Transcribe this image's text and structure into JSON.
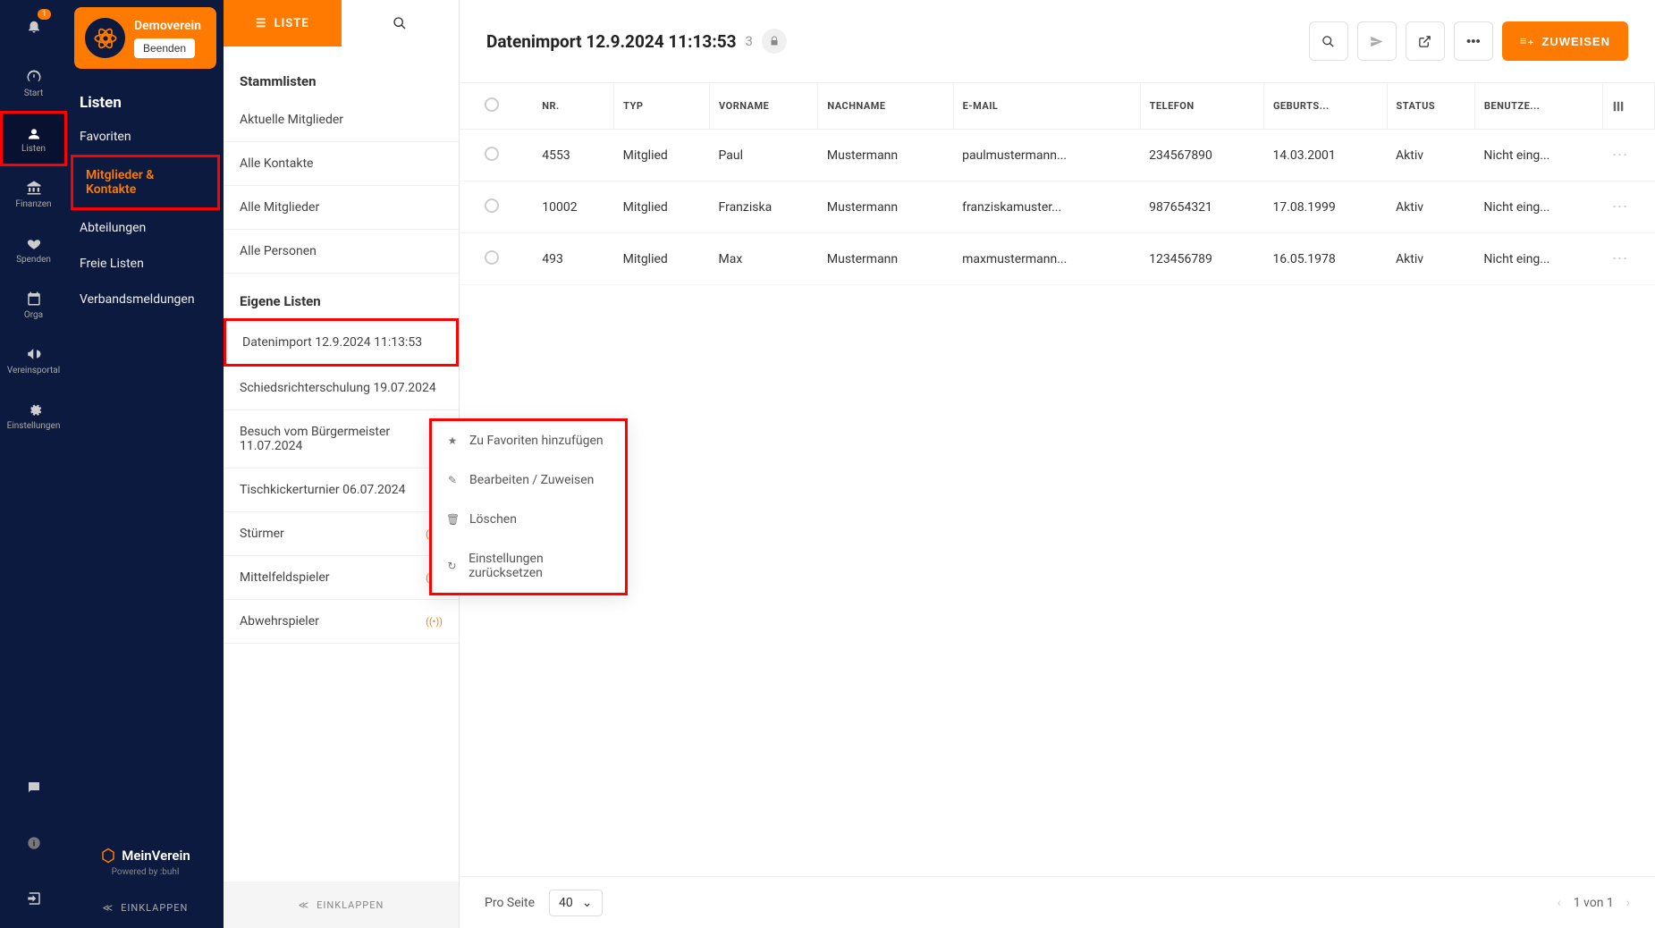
{
  "org": {
    "name": "Demoverein",
    "exit_label": "Beenden"
  },
  "rail": {
    "items": [
      {
        "icon": "bell",
        "label": "",
        "badge": "1"
      },
      {
        "icon": "dashboard",
        "label": "Start"
      },
      {
        "icon": "users",
        "label": "Listen",
        "active": true,
        "highlighted": true
      },
      {
        "icon": "bank",
        "label": "Finanzen"
      },
      {
        "icon": "hands",
        "label": "Spenden"
      },
      {
        "icon": "calendar",
        "label": "Orga"
      },
      {
        "icon": "megaphone",
        "label": "Vereinsportal"
      },
      {
        "icon": "gear",
        "label": "Einstellungen"
      }
    ],
    "bottom": [
      {
        "icon": "chat",
        "label": ""
      },
      {
        "icon": "info",
        "label": ""
      },
      {
        "icon": "logout",
        "label": ""
      }
    ]
  },
  "side2": {
    "heading": "Listen",
    "items": [
      {
        "label": "Favoriten"
      },
      {
        "label": "Mitglieder & Kontakte",
        "active": true,
        "highlighted": true
      },
      {
        "label": "Abteilungen"
      },
      {
        "label": "Freie Listen"
      },
      {
        "label": "Verbandsmeldungen"
      }
    ],
    "brand": "MeinVerein",
    "powered": "Powered by :buhl",
    "collapse": "EINKLAPPEN"
  },
  "panel3": {
    "tab_label": "LISTE",
    "sections": [
      {
        "title": "Stammlisten",
        "items": [
          {
            "label": "Aktuelle Mitglieder"
          },
          {
            "label": "Alle Kontakte"
          },
          {
            "label": "Alle Mitglieder"
          },
          {
            "label": "Alle Personen"
          }
        ]
      },
      {
        "title": "Eigene Listen",
        "items": [
          {
            "label": "Datenimport 12.9.2024 11:13:53",
            "highlighted": true
          },
          {
            "label": "Schiedsrichterschulung 19.07.2024"
          },
          {
            "label": "Besuch vom Bürgermeister 11.07.2024"
          },
          {
            "label": "Tischkickerturnier 06.07.2024"
          },
          {
            "label": "Stürmer",
            "live": true
          },
          {
            "label": "Mittelfeldspieler",
            "live": true
          },
          {
            "label": "Abwehrspieler",
            "live": true
          }
        ]
      }
    ],
    "collapse": "EINKLAPPEN"
  },
  "context_menu": {
    "items": [
      {
        "icon": "★",
        "label": "Zu Favoriten hinzufügen"
      },
      {
        "icon": "✎",
        "label": "Bearbeiten / Zuweisen"
      },
      {
        "icon": "🗑",
        "label": "Löschen"
      },
      {
        "icon": "↻",
        "label": "Einstellungen zurücksetzen"
      }
    ]
  },
  "main": {
    "title": "Datenimport 12.9.2024 11:13:53",
    "count": "3",
    "assign_label": "ZUWEISEN",
    "columns": [
      "NR.",
      "TYP",
      "VORNAME",
      "NACHNAME",
      "E-MAIL",
      "TELEFON",
      "GEBURTS...",
      "STATUS",
      "BENUTZE..."
    ],
    "rows": [
      {
        "nr": "4553",
        "typ": "Mitglied",
        "vorname": "Paul",
        "nachname": "Mustermann",
        "email": "paulmustermann...",
        "tel": "234567890",
        "geb": "14.03.2001",
        "status": "Aktiv",
        "benutzer": "Nicht eing..."
      },
      {
        "nr": "10002",
        "typ": "Mitglied",
        "vorname": "Franziska",
        "nachname": "Mustermann",
        "email": "franziskamuster...",
        "tel": "987654321",
        "geb": "17.08.1999",
        "status": "Aktiv",
        "benutzer": "Nicht eing..."
      },
      {
        "nr": "493",
        "typ": "Mitglied",
        "vorname": "Max",
        "nachname": "Mustermann",
        "email": "maxmustermann...",
        "tel": "123456789",
        "geb": "16.05.1978",
        "status": "Aktiv",
        "benutzer": "Nicht eing..."
      }
    ],
    "footer": {
      "per_page_label": "Pro Seite",
      "per_page_value": "40",
      "page_text": "1 von 1"
    }
  }
}
